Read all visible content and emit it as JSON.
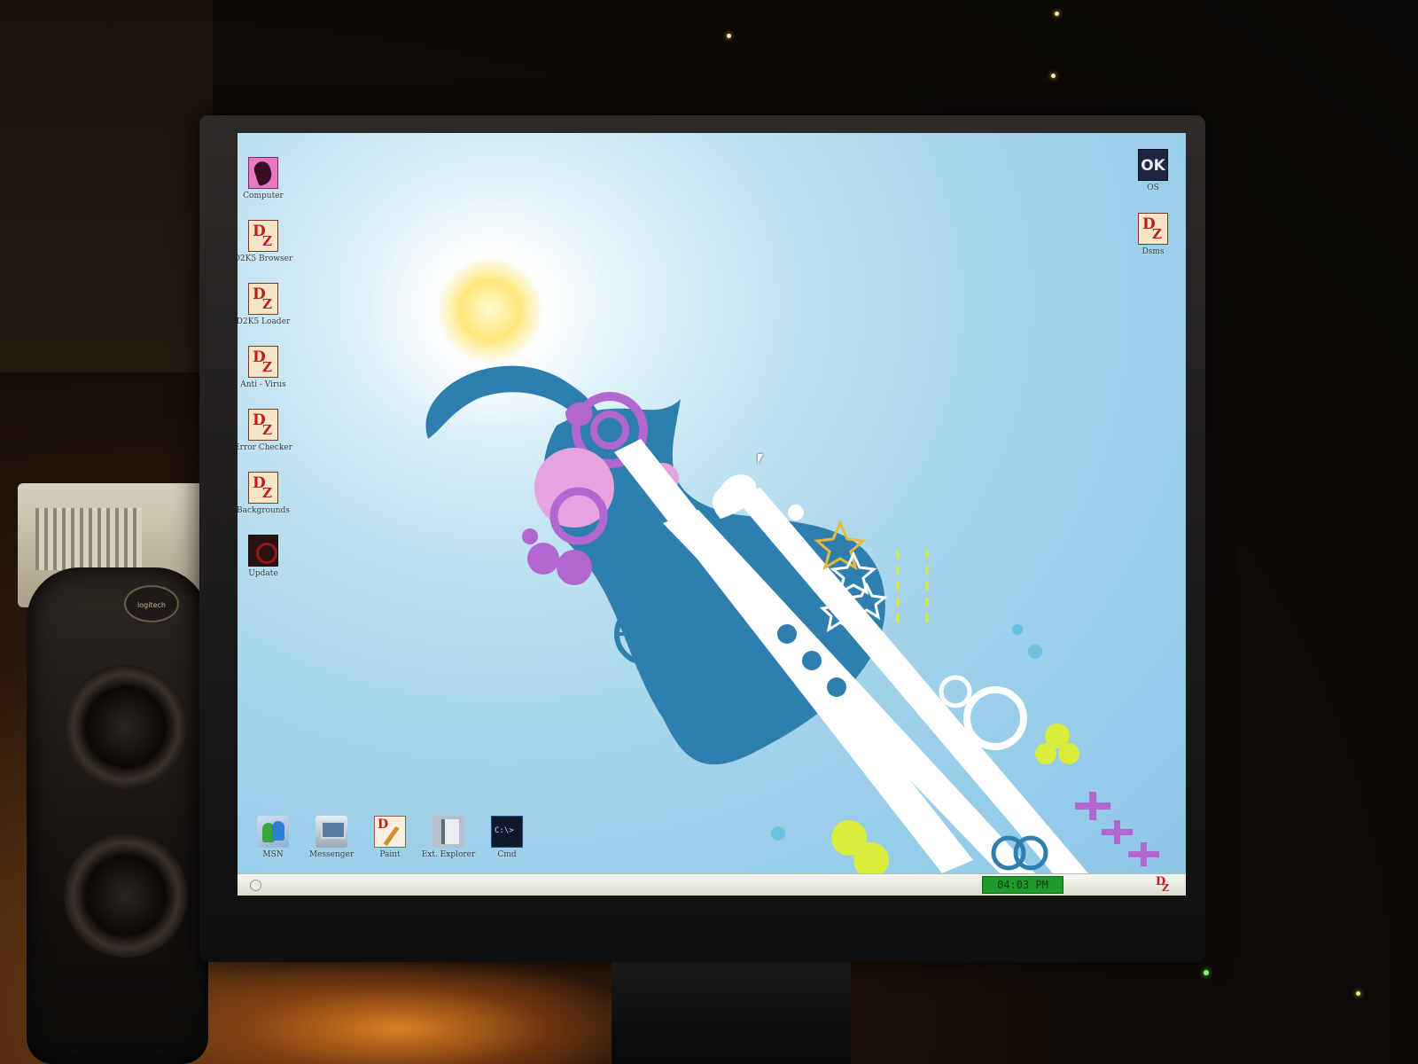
{
  "desktop": {
    "left_icons": [
      {
        "label": "Computer",
        "icon": "computer-icon"
      },
      {
        "label": "D2K5 Browser",
        "icon": "d2k5-logo-icon"
      },
      {
        "label": "D2K5 Loader",
        "icon": "d2k5-logo-icon"
      },
      {
        "label": "Anti - Virus",
        "icon": "d2k5-logo-icon"
      },
      {
        "label": "Error Checker",
        "icon": "d2k5-logo-icon"
      },
      {
        "label": "Backgrounds",
        "icon": "d2k5-logo-icon"
      },
      {
        "label": "Update",
        "icon": "update-icon"
      }
    ],
    "right_icons": [
      {
        "label": "OK",
        "caption": "OS",
        "icon": "ok-icon"
      },
      {
        "label": "",
        "caption": "Dsms",
        "icon": "d2k5-logo-icon"
      }
    ],
    "dock_icons": [
      {
        "label": "MSN",
        "icon": "msn-messenger-icon"
      },
      {
        "label": "Messenger",
        "icon": "messenger-icon"
      },
      {
        "label": "Paint",
        "icon": "paint-icon"
      },
      {
        "label": "Ext. Explorer",
        "icon": "explorer-icon"
      },
      {
        "label": "Cmd",
        "icon": "command-prompt-icon"
      }
    ]
  },
  "taskbar": {
    "clock": "04:03 PM",
    "clock_color": "#1e9a2c",
    "tray_icon": "d2k5-logo-icon"
  },
  "colors": {
    "wallpaper_sky": "#9fd1ea",
    "wallpaper_teal": "#2f7fae",
    "wallpaper_purple": "#b266d1",
    "wallpaper_pink": "#e5a3e0",
    "wallpaper_lime": "#d9ee3a"
  }
}
